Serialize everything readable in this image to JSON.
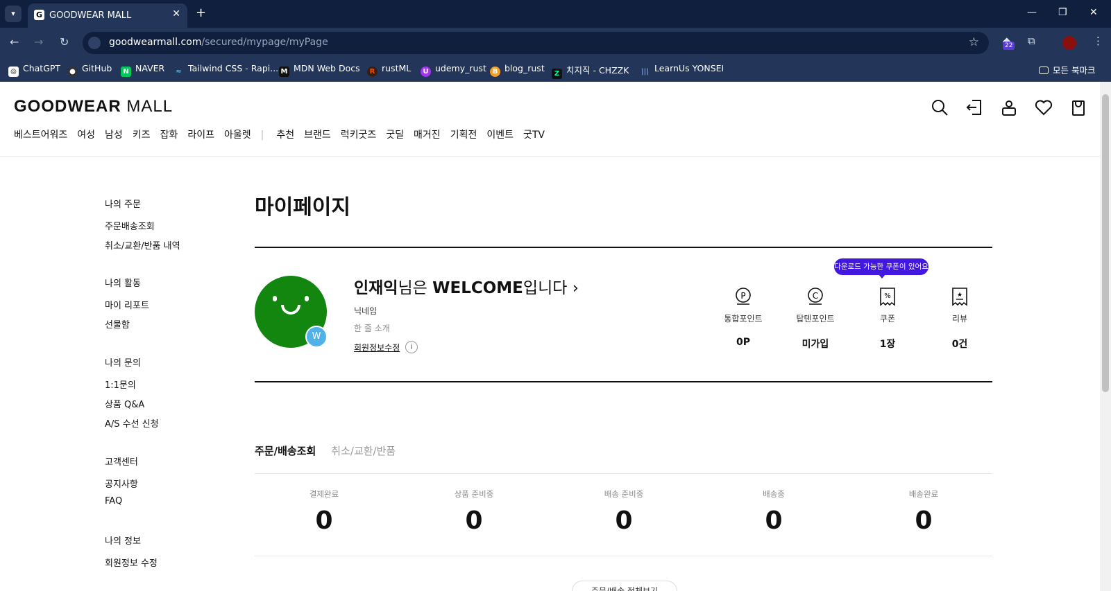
{
  "browser": {
    "tab_title": "GOODWEAR MALL",
    "tab_favicon": "G",
    "url_host": "goodwearmall.com",
    "url_path": "/secured/mypage/myPage",
    "extension_badge": "22",
    "bookmarks": [
      {
        "label": "ChatGPT",
        "icon": "chatgpt-icon",
        "color": "#ffffff"
      },
      {
        "label": "GitHub",
        "icon": "github-icon",
        "color": "#333333"
      },
      {
        "label": "NAVER",
        "icon": "naver-icon",
        "color": "#03c75a"
      },
      {
        "label": "Tailwind CSS - Rapi...",
        "icon": "tailwind-icon",
        "color": "#38bdf8"
      },
      {
        "label": "MDN Web Docs",
        "icon": "mdn-icon",
        "color": "#111111"
      },
      {
        "label": "rustML",
        "icon": "rust-icon",
        "color": "#3a1d10"
      },
      {
        "label": "udemy_rust",
        "icon": "udemy-icon",
        "color": "#a435f0"
      },
      {
        "label": "blog_rust",
        "icon": "blog-icon",
        "color": "#f0a030"
      },
      {
        "label": "치지직 - CHZZK",
        "icon": "chzzk-icon",
        "color": "#111111"
      },
      {
        "label": "LearnUs YONSEI",
        "icon": "learnus-icon",
        "color": "#2b5fb8"
      }
    ],
    "all_bookmarks": "모든 북마크"
  },
  "site": {
    "logo_bold": "GOODWEAR",
    "logo_light": "MALL",
    "nav_left": [
      "베스트어워즈",
      "여성",
      "남성",
      "키즈",
      "잡화",
      "라이프",
      "아울렛"
    ],
    "nav_right": [
      "추천",
      "브랜드",
      "럭키굿즈",
      "굿딜",
      "매거진",
      "기획전",
      "이벤트",
      "굿TV"
    ]
  },
  "sidebar": [
    {
      "heading": "나의 주문",
      "items": [
        "주문배송조회",
        "취소/교환/반품 내역"
      ]
    },
    {
      "heading": "나의 활동",
      "items": [
        "마이 리포트",
        "선물함"
      ]
    },
    {
      "heading": "나의 문의",
      "items": [
        "1:1문의",
        "상품 Q&A",
        "A/S 수선 신청"
      ]
    },
    {
      "heading": "고객센터",
      "items": [
        "공지사항",
        "FAQ"
      ]
    },
    {
      "heading": "나의 정보",
      "items": [
        "회원정보 수정"
      ]
    }
  ],
  "mypage": {
    "title": "마이페이지",
    "avatar_badge": "W",
    "user_name": "인재익",
    "welcome_mid": "님은",
    "grade": "WELCOME",
    "welcome_end": "입니다",
    "chevron": "›",
    "nickname": "닉네임",
    "intro": "한 줄 소개",
    "edit_link": "회원정보수정",
    "info": "i",
    "coupon_tooltip": "다운로드 가능한 쿠폰이 있어요",
    "stats": [
      {
        "label": "통합포인트",
        "value": "0P",
        "icon": "point-p-icon"
      },
      {
        "label": "탑텐포인트",
        "value": "미가입",
        "icon": "point-c-icon"
      },
      {
        "label": "쿠폰",
        "value": "1장",
        "icon": "coupon-icon"
      },
      {
        "label": "리뷰",
        "value": "0건",
        "icon": "review-icon"
      }
    ]
  },
  "orders": {
    "tab_active": "주문/배송조회",
    "tab_inactive": "취소/교환/반품",
    "statuses": [
      {
        "label": "결제완료",
        "count": "0"
      },
      {
        "label": "상품 준비중",
        "count": "0"
      },
      {
        "label": "배송 준비중",
        "count": "0"
      },
      {
        "label": "배송중",
        "count": "0"
      },
      {
        "label": "배송완료",
        "count": "0"
      }
    ],
    "more_button": "주문/배송 전체보기"
  }
}
